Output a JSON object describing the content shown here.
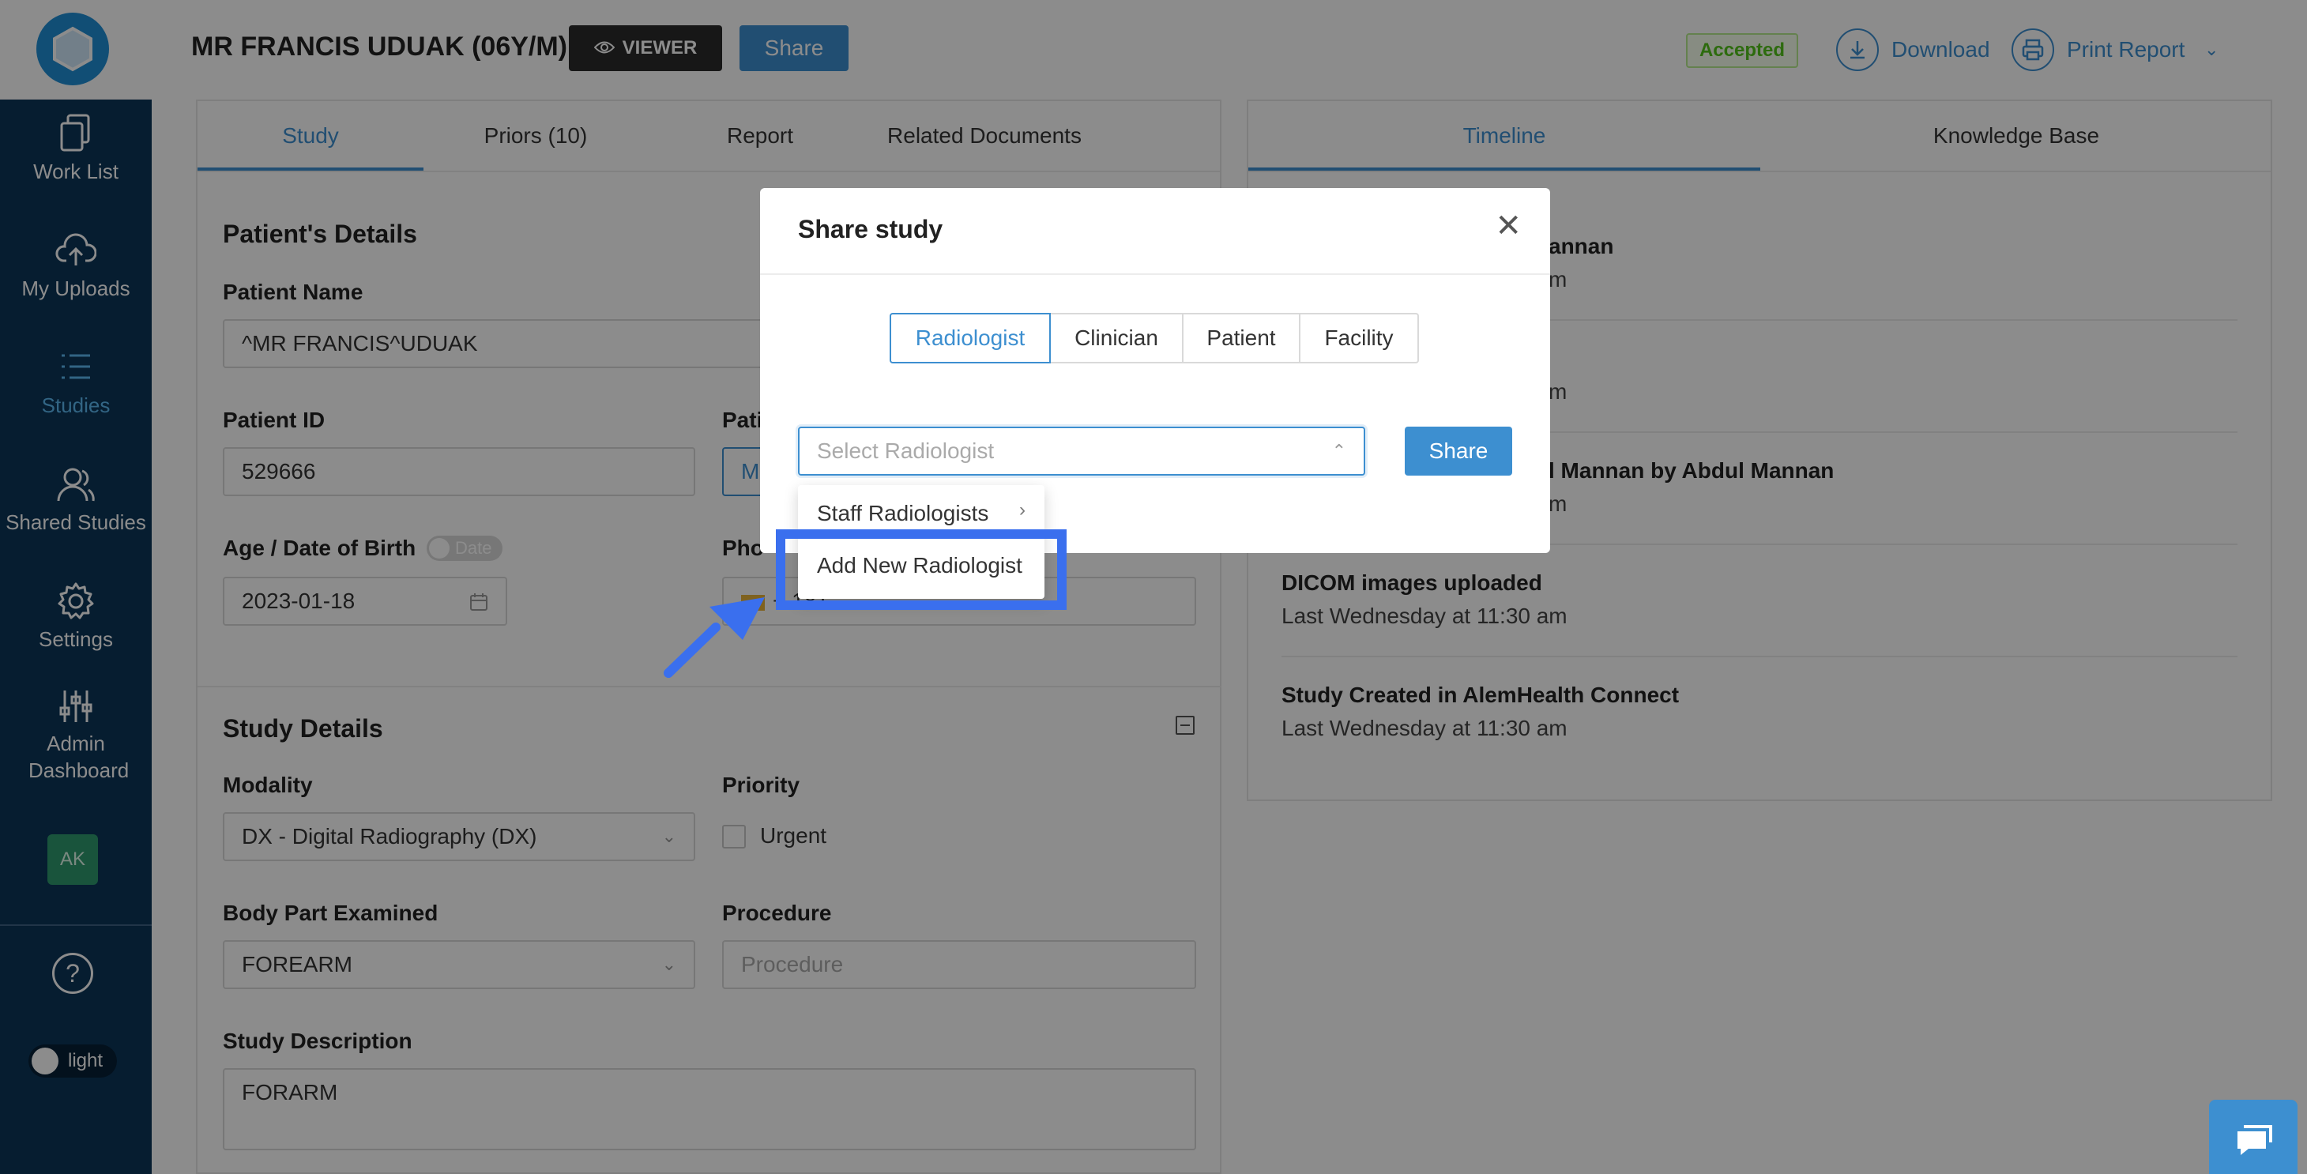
{
  "sidebar": {
    "items": [
      {
        "label": "Work List",
        "icon": "document-copy-icon"
      },
      {
        "label": "My Uploads",
        "icon": "cloud-upload-icon"
      },
      {
        "label": "Studies",
        "icon": "list-icon"
      },
      {
        "label": "Shared Studies",
        "icon": "users-icon"
      },
      {
        "label": "Settings",
        "icon": "gear-icon"
      },
      {
        "label": "Admin Dashboard",
        "icon": "sliders-icon"
      }
    ],
    "avatar": "AK",
    "help": "?",
    "theme_toggle": "light"
  },
  "header": {
    "patient": "MR FRANCIS UDUAK (06Y/M)",
    "viewer_label": "VIEWER",
    "share_label": "Share",
    "status": "Accepted",
    "download_label": "Download",
    "print_label": "Print Report"
  },
  "left_panel": {
    "tabs": [
      "Study",
      "Priors (10)",
      "Report",
      "Related Documents"
    ],
    "patient_details_title": "Patient's Details",
    "patient_name_label": "Patient Name",
    "patient_name_value": "^MR FRANCIS^UDUAK",
    "patient_id_label": "Patient ID",
    "patient_id_value": "529666",
    "gender_label_partial": "Pati",
    "gender_value_partial": "M",
    "age_label": "Age / Date of Birth",
    "date_toggle": "Date",
    "dob_value": "2023-01-18",
    "phone_label_partial": "Pho",
    "phone_value_partial": "+ 181",
    "study_details_title": "Study Details",
    "modality_label": "Modality",
    "modality_value": "DX - Digital Radiography (DX)",
    "priority_label": "Priority",
    "urgent_label": "Urgent",
    "body_part_label": "Body Part Examined",
    "body_part_value": "FOREARM",
    "procedure_label": "Procedure",
    "procedure_placeholder": "Procedure",
    "description_label": "Study Description",
    "description_value": "FORARM"
  },
  "right_panel": {
    "tabs": [
      "Timeline",
      "Knowledge Base"
    ],
    "timeline": [
      {
        "title": "annan",
        "time": "m"
      },
      {
        "title": "",
        "time": "m"
      },
      {
        "title": "l Mannan by Abdul Mannan",
        "time": "m"
      },
      {
        "title": "DICOM images uploaded",
        "time": "Last Wednesday at 11:30 am"
      },
      {
        "title": "Study Created in AlemHealth Connect",
        "time": "Last Wednesday at 11:30 am"
      }
    ]
  },
  "modal": {
    "title": "Share study",
    "segments": [
      "Radiologist",
      "Clinician",
      "Patient",
      "Facility"
    ],
    "active_segment": "Radiologist",
    "select_placeholder": "Select Radiologist",
    "share_label": "Share",
    "dropdown": [
      "Staff Radiologists",
      "Add New Radiologist"
    ]
  },
  "colors": {
    "accent": "#3d8fd0",
    "sidebar": "#0b3558",
    "highlight": "#3a6fee",
    "accepted": "#52c41a"
  }
}
